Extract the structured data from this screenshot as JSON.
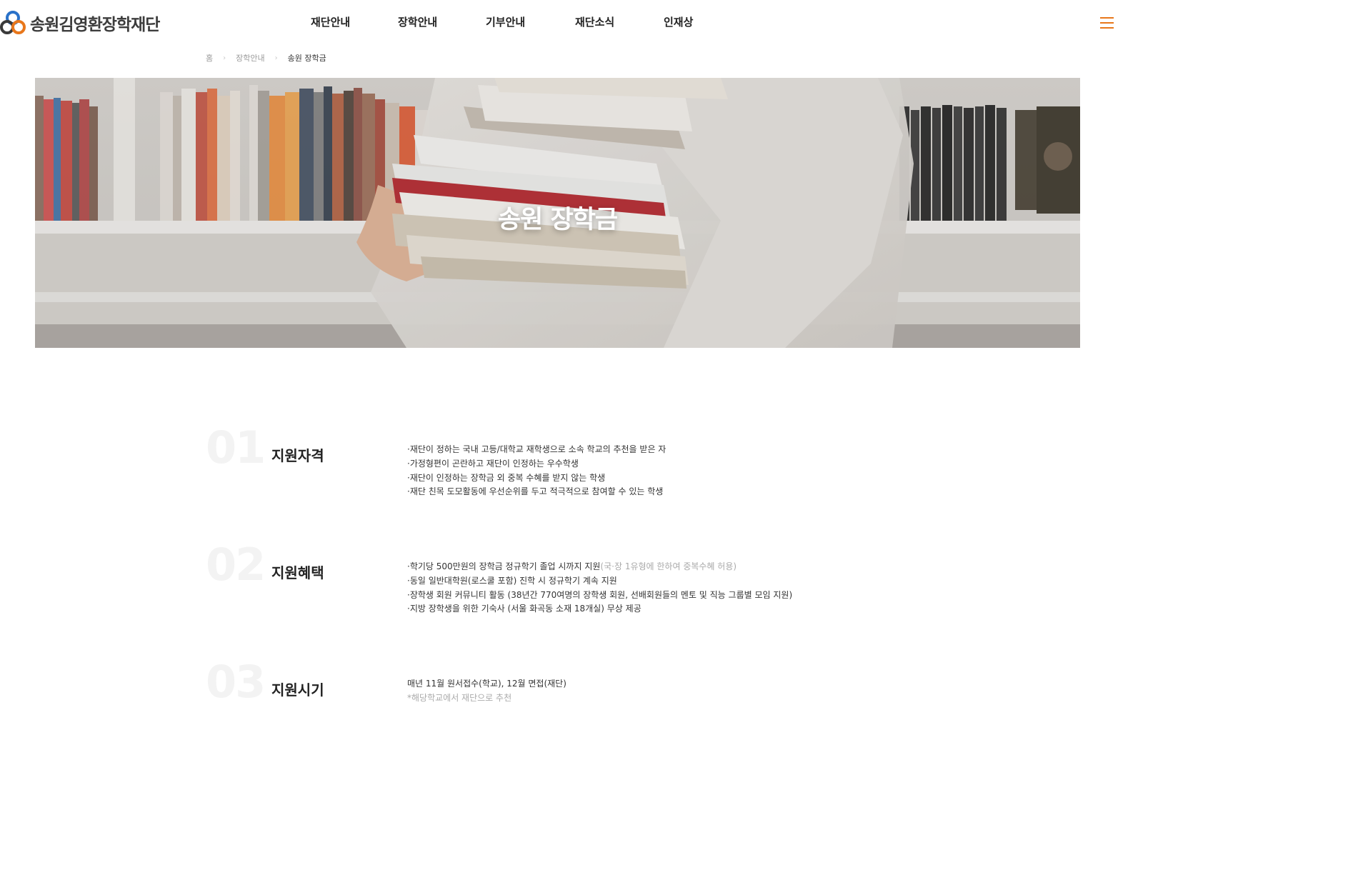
{
  "header": {
    "logo_text": "송원김영환장학재단",
    "nav": [
      "재단안내",
      "장학안내",
      "기부안내",
      "재단소식",
      "인재상"
    ]
  },
  "breadcrumb": {
    "home": "홈",
    "parent": "장학안내",
    "current": "송원 장학금"
  },
  "hero": {
    "title": "송원 장학금"
  },
  "sections": [
    {
      "num": "01",
      "title": "지원자격",
      "items": [
        {
          "text": "·재단이 정하는 국내 고등/대학교 재학생으로 소속 학교의 추천을 받은 자"
        },
        {
          "text": "·가정형편이 곤란하고 재단이 인정하는 우수학생"
        },
        {
          "text": "·재단이 인정하는 장학금 외 중복 수혜를 받지 않는 학생"
        },
        {
          "text": "·재단 친목 도모활동에 우선순위를 두고 적극적으로 참여할 수 있는 학생"
        }
      ]
    },
    {
      "num": "02",
      "title": "지원혜택",
      "items": [
        {
          "text": "·학기당 500만원의 장학금 정규학기 졸업 시까지 지원",
          "note": "(국·장 1유형에 한하여 중복수혜 허용)"
        },
        {
          "text": "·동일 일반대학원(로스쿨 포함) 진학 시 정규학기 계속 지원"
        },
        {
          "text": "·장학생 회원 커뮤니티 활동 (38년간 770여명의 장학생 회원, 선배회원들의 멘토 및 직능 그룹별 모임 지원)"
        },
        {
          "text": "·지방 장학생을 위한 기숙사 (서울 화곡동 소재 18개실) 무상 제공"
        }
      ]
    },
    {
      "num": "03",
      "title": "지원시기",
      "items": [
        {
          "text": "매년 11월 원서접수(학교), 12월 면접(재단)"
        },
        {
          "note": "*해당학교에서 재단으로 추천"
        }
      ]
    }
  ]
}
